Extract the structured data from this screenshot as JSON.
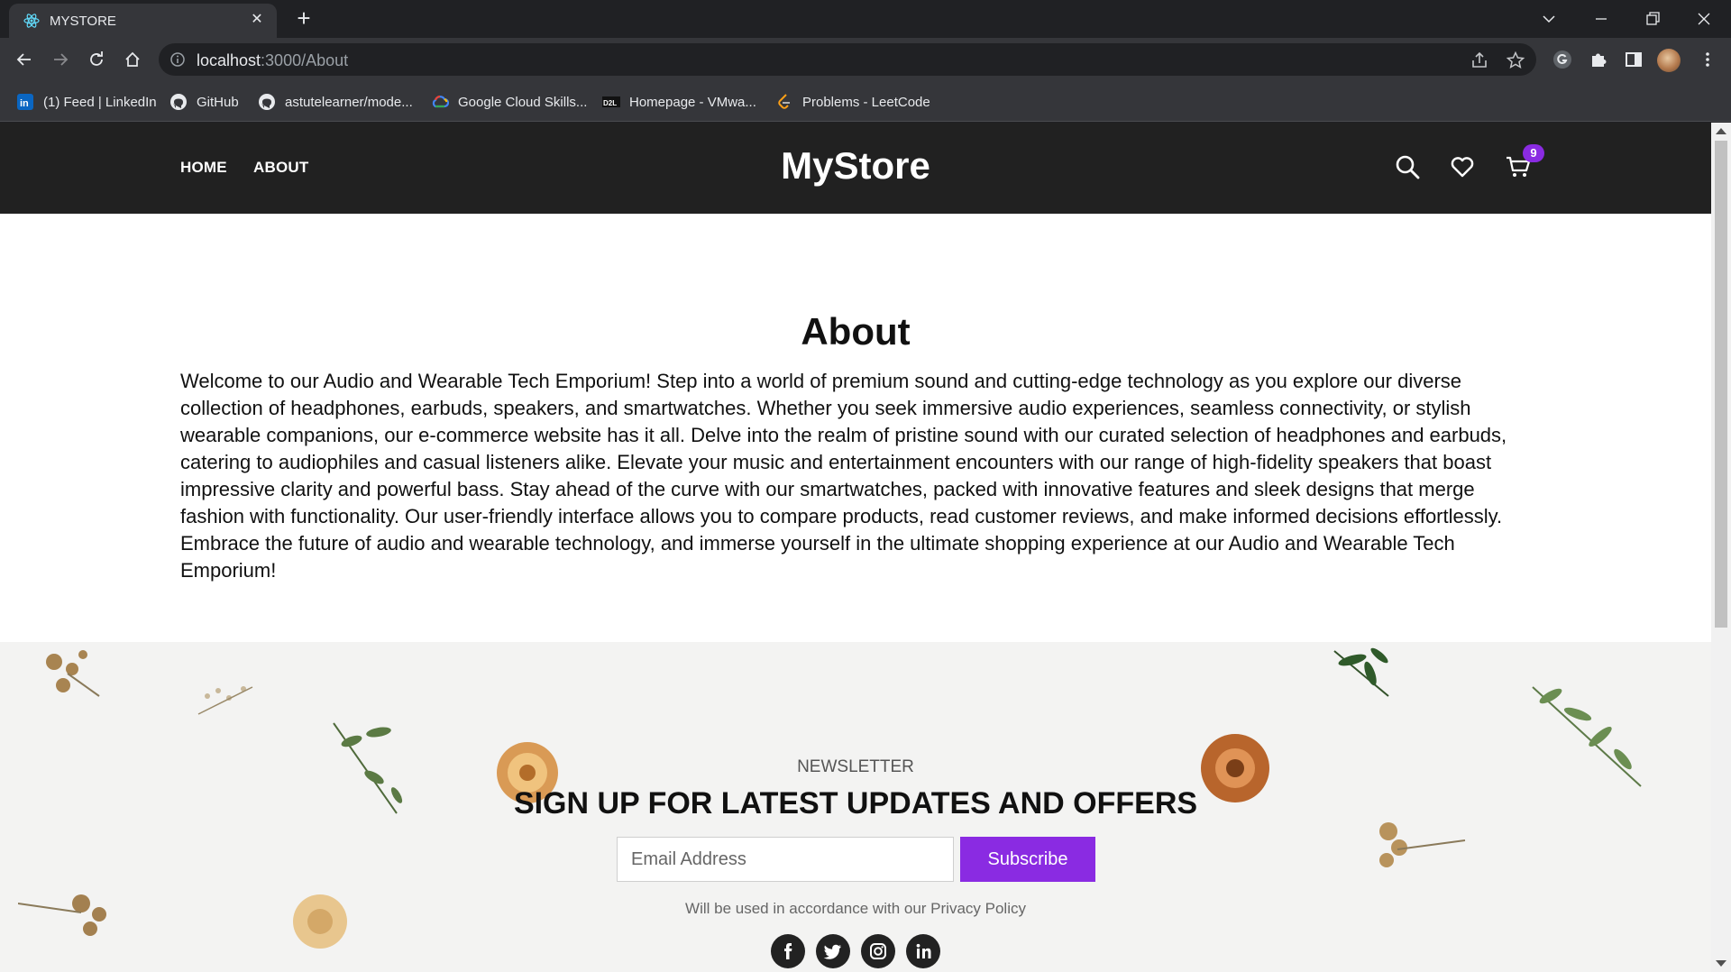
{
  "browser": {
    "tab_title": "MYSTORE",
    "url_host": "localhost",
    "url_path": ":3000/About",
    "bookmarks": [
      {
        "label": "(1) Feed | LinkedIn",
        "icon": "linkedin-icon"
      },
      {
        "label": "GitHub",
        "icon": "github-icon"
      },
      {
        "label": "astutelearner/mode...",
        "icon": "github-icon"
      },
      {
        "label": "Google Cloud Skills...",
        "icon": "google-cloud-icon"
      },
      {
        "label": "Homepage - VMwa...",
        "icon": "d2l-icon"
      },
      {
        "label": "Problems - LeetCode",
        "icon": "leetcode-icon"
      }
    ]
  },
  "header": {
    "nav": [
      {
        "label": "HOME"
      },
      {
        "label": "ABOUT"
      }
    ],
    "brand": "MyStore",
    "cart_count": "9",
    "icons": [
      "search-icon",
      "heart-icon",
      "cart-icon"
    ]
  },
  "about": {
    "title": "About",
    "text": "Welcome to our Audio and Wearable Tech Emporium! Step into a world of premium sound and cutting-edge technology as you explore our diverse collection of headphones, earbuds, speakers, and smartwatches. Whether you seek immersive audio experiences, seamless connectivity, or stylish wearable companions, our e-commerce website has it all. Delve into the realm of pristine sound with our curated selection of headphones and earbuds, catering to audiophiles and casual listeners alike. Elevate your music and entertainment encounters with our range of high-fidelity speakers that boast impressive clarity and powerful bass. Stay ahead of the curve with our smartwatches, packed with innovative features and sleek designs that merge fashion with functionality. Our user-friendly interface allows you to compare products, read customer reviews, and make informed decisions effortlessly. Embrace the future of audio and wearable technology, and immerse yourself in the ultimate shopping experience at our Audio and Wearable Tech Emporium!"
  },
  "newsletter": {
    "kicker": "NEWSLETTER",
    "title": "SIGN UP FOR LATEST UPDATES AND OFFERS",
    "email_placeholder": "Email Address",
    "button": "Subscribe",
    "note": "Will be used in accordance with our Privacy Policy",
    "social": [
      {
        "glyph": "f",
        "icon": "facebook-icon"
      },
      {
        "glyph": "t",
        "icon": "twitter-icon"
      },
      {
        "glyph": "ig",
        "icon": "instagram-icon"
      },
      {
        "glyph": "in",
        "icon": "linkedin-icon"
      }
    ]
  },
  "colors": {
    "accent": "#8a2be2",
    "header_bg": "#212121",
    "chrome_bg": "#35363a"
  }
}
